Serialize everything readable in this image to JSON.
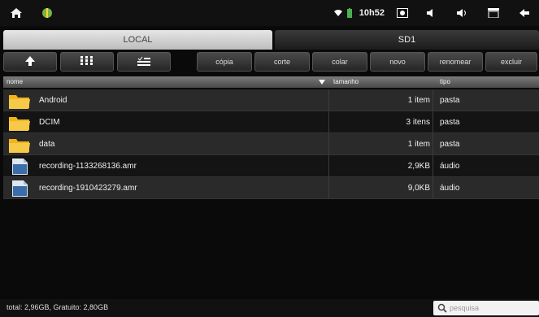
{
  "status_bar": {
    "time": "10h52",
    "icons": [
      "home-icon",
      "android-icon",
      "wifi-icon",
      "battery-icon",
      "screenshot-icon",
      "volume-down-icon",
      "volume-up-icon",
      "menu-icon",
      "back-icon"
    ]
  },
  "tabs": [
    {
      "label": "LOCAL",
      "active": true
    },
    {
      "label": "SD1",
      "active": false
    }
  ],
  "toolbar": {
    "icon_buttons": [
      "up-arrow-icon",
      "grid-icon",
      "multiselect-icon"
    ],
    "actions": [
      "cópia",
      "corte",
      "colar",
      "novo",
      "renomear",
      "excluir"
    ]
  },
  "columns": {
    "name": "nome",
    "size": "tamanho",
    "type": "tipo"
  },
  "files": [
    {
      "name": "Android",
      "size": "1 item",
      "type": "pasta",
      "kind": "folder"
    },
    {
      "name": "DCIM",
      "size": "3 itens",
      "type": "pasta",
      "kind": "folder"
    },
    {
      "name": "data",
      "size": "1 item",
      "type": "pasta",
      "kind": "folder"
    },
    {
      "name": "recording-1133268136.amr",
      "size": "2,9KB",
      "type": "áudio",
      "kind": "audio"
    },
    {
      "name": "recording-1910423279.amr",
      "size": "9,0KB",
      "type": "áudio",
      "kind": "audio"
    }
  ],
  "footer": {
    "total": "total: 2,96GB, Gratuito: 2,80GB",
    "search_placeholder": "pesquisa"
  },
  "colors": {
    "folder": "#f3b41a",
    "audio_file": "#3b6ea8",
    "active_tab": "#d6d6d6"
  }
}
